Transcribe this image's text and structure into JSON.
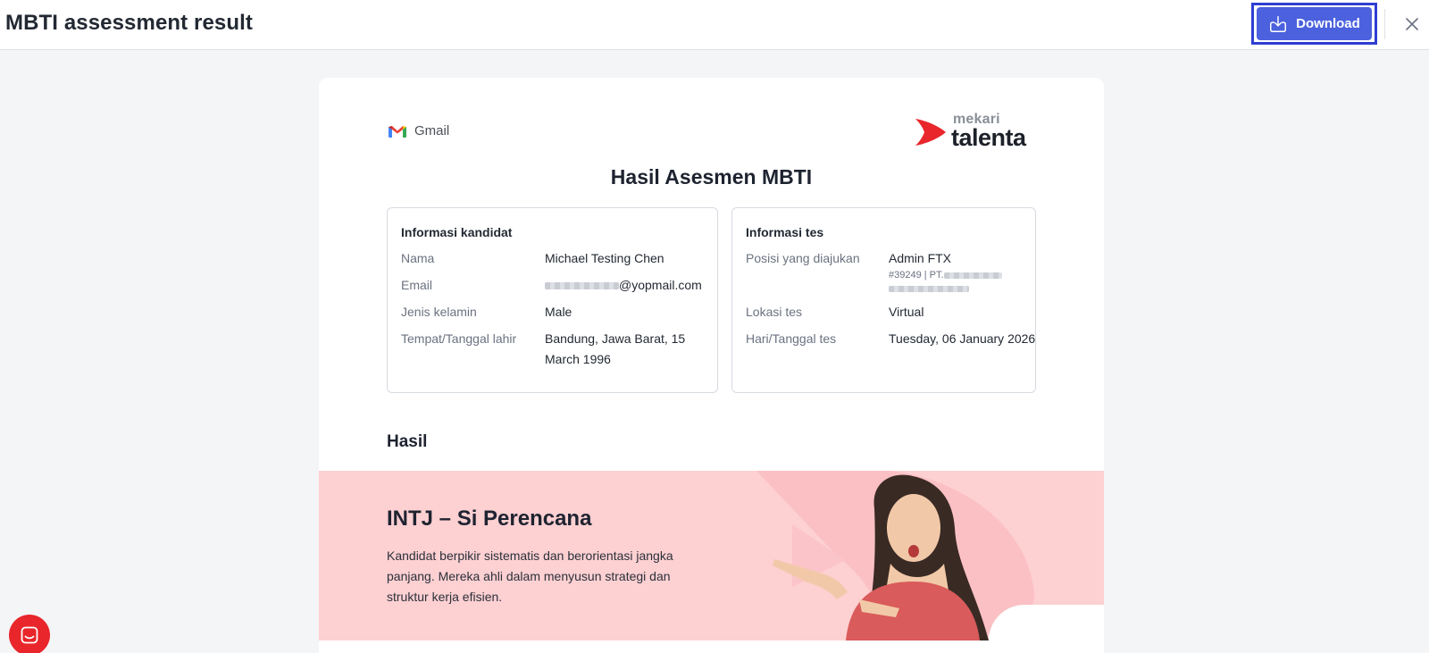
{
  "header": {
    "title": "MBTI assessment result",
    "download_label": "Download"
  },
  "report": {
    "source_label": "Gmail",
    "brand_top": "mekari",
    "brand_bottom": "talenta",
    "title": "Hasil Asesmen MBTI",
    "candidate_card": {
      "heading": "Informasi kandidat",
      "rows": [
        {
          "label": "Nama",
          "value": "Michael Testing Chen"
        },
        {
          "label": "Email",
          "value": "@yopmail.com"
        },
        {
          "label": "Jenis kelamin",
          "value": "Male"
        },
        {
          "label": "Tempat/Tanggal lahir",
          "value": "Bandung, Jawa Barat, 15 March 1996"
        }
      ]
    },
    "test_card": {
      "heading": "Informasi tes",
      "rows": [
        {
          "label": "Posisi yang diajukan",
          "value": "Admin FTX",
          "note": "#39249 | PT."
        },
        {
          "label": "Lokasi tes",
          "value": "Virtual"
        },
        {
          "label": "Hari/Tanggal tes",
          "value": "Tuesday, 06 January 2026"
        }
      ]
    },
    "result_heading": "Hasil",
    "result": {
      "type_title": "INTJ – Si Perencana",
      "description": "Kandidat berpikir sistematis dan berorientasi jangka panjang. Mereka ahli dalam menyusun strategi dan struktur kerja efisien."
    }
  },
  "colors": {
    "accent": "#4b61dd",
    "accent_outline": "#2f3ed1",
    "banner_bg": "#fdd0d2",
    "brand_red": "#e8262b"
  },
  "icons": [
    "download-icon",
    "close-icon",
    "gmail-icon",
    "mekari-talenta-logo",
    "chat-icon"
  ]
}
